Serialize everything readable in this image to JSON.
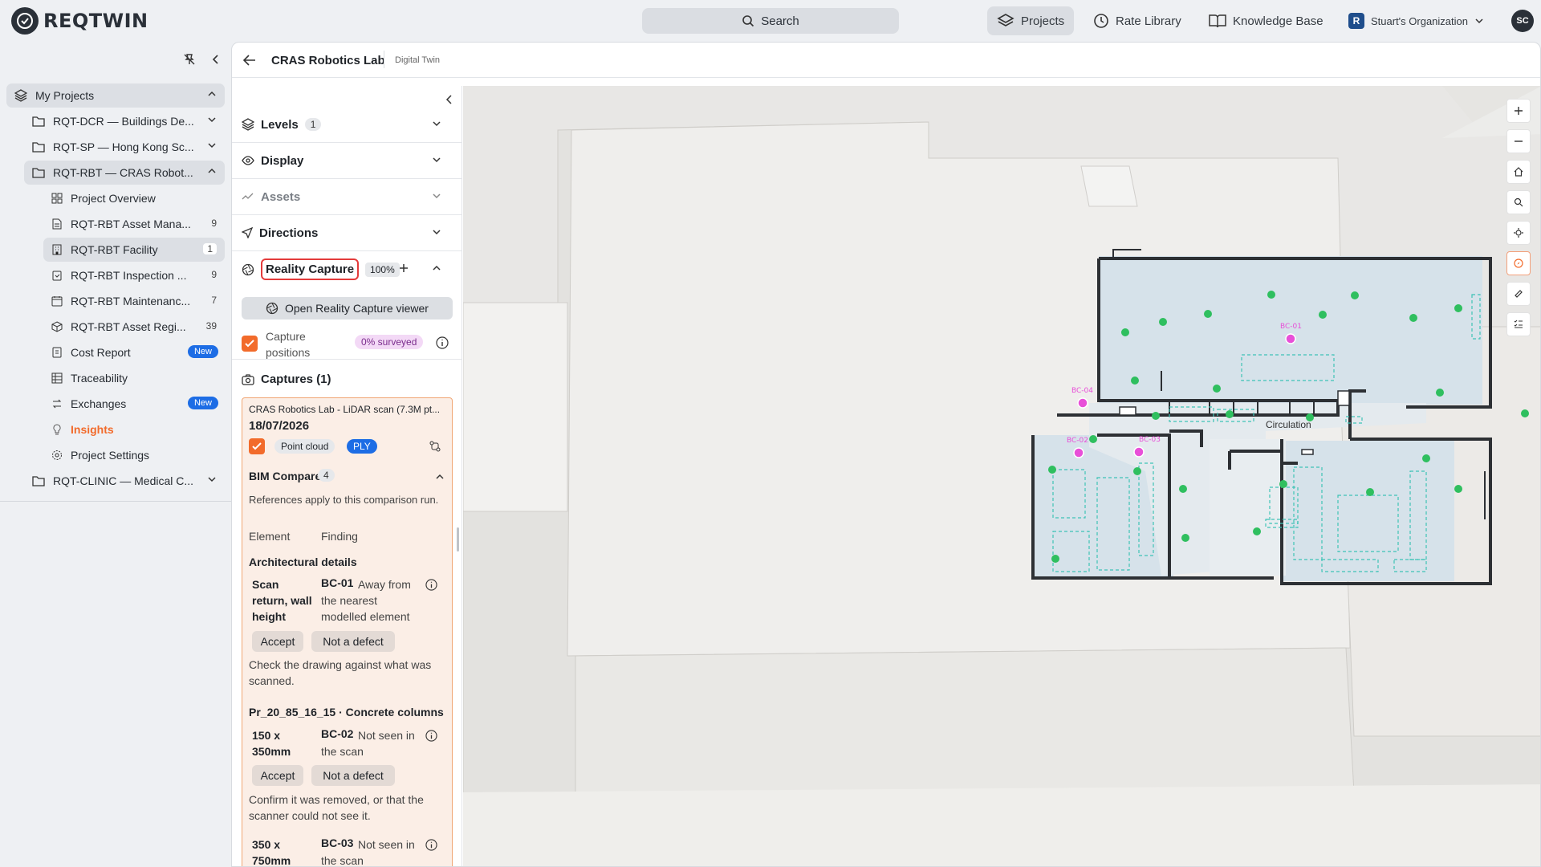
{
  "app": {
    "logo_text": "REQTWIN",
    "user_initials": "SC"
  },
  "topbar": {
    "search_label": "Search",
    "nav": [
      {
        "label": "Projects",
        "icon": "layers-icon",
        "active": true
      },
      {
        "label": "Rate Library",
        "icon": "rate-icon"
      },
      {
        "label": "Knowledge Base",
        "icon": "book-icon"
      }
    ],
    "org": {
      "badge": "R",
      "label": "Stuart's Organization"
    }
  },
  "sidebar": {
    "root_label": "My Projects",
    "projects": [
      {
        "label": "RQT-DCR — Buildings De..."
      },
      {
        "label": "RQT-SP — Hong Kong Sc..."
      },
      {
        "label": "RQT-RBT — CRAS Robot..."
      }
    ],
    "children": [
      {
        "label": "Project Overview",
        "icon": "grid-icon"
      },
      {
        "label": "RQT-RBT Asset Mana...",
        "icon": "document-icon",
        "count": "9"
      },
      {
        "label": "RQT-RBT Facility",
        "icon": "building-icon",
        "count": "1"
      },
      {
        "label": "RQT-RBT Inspection ...",
        "icon": "clipboard-icon",
        "count": "9"
      },
      {
        "label": "RQT-RBT Maintenanc...",
        "icon": "calendar-icon",
        "count": "7"
      },
      {
        "label": "RQT-RBT Asset Regi...",
        "icon": "cube-icon",
        "count": "39"
      },
      {
        "label": "Cost Report",
        "icon": "cost-icon",
        "badge": "New"
      },
      {
        "label": "Traceability",
        "icon": "table-icon"
      },
      {
        "label": "Exchanges",
        "icon": "exchange-icon",
        "badge": "New"
      },
      {
        "label": "Insights",
        "icon": "lightbulb-icon"
      },
      {
        "label": "Project Settings",
        "icon": "settings-icon"
      }
    ],
    "last_project": "RQT-CLINIC — Medical C..."
  },
  "breadcrumb": {
    "title": "CRAS Robotics Lab",
    "subtitle": "Digital Twin"
  },
  "panel": {
    "levels": {
      "label": "Levels",
      "count": "1"
    },
    "display": {
      "label": "Display"
    },
    "assets": {
      "label": "Assets"
    },
    "directions": {
      "label": "Directions"
    },
    "reality": {
      "label": "Reality Capture",
      "percent": "100%"
    },
    "open_viewer": "Open Reality Capture viewer",
    "capture_positions": "Capture positions",
    "surveyed": "0% surveyed",
    "captures_title": "Captures (1)",
    "capture": {
      "name": "CRAS Robotics Lab - LiDAR scan (7.3M pt...",
      "date": "18/07/2026",
      "tag1": "Point cloud",
      "tag2": "PLY"
    },
    "bim": {
      "title": "BIM Compare",
      "count": "4",
      "note": "References apply to this comparison run.",
      "col_element": "Element",
      "col_finding": "Finding",
      "groups": [
        {
          "heading": "Architectural details",
          "element": "Scan return, wall height",
          "code": "BC-01",
          "finding": "Away from the nearest modelled element",
          "accept": "Accept",
          "reject": "Not a defect",
          "hint": "Check the drawing against what was scanned."
        },
        {
          "heading": "Pr_20_85_16_15 · Concrete columns",
          "element": "150 x 350mm",
          "code": "BC-02",
          "finding": "Not seen in the scan",
          "accept": "Accept",
          "reject": "Not a defect",
          "hint": "Confirm it was removed, or that the scanner could not see it."
        },
        {
          "element": "350 x 750mm",
          "code": "BC-03",
          "finding": "Not seen in the scan"
        }
      ]
    }
  },
  "map": {
    "room_label": "Circulation",
    "markers": [
      "BC-01",
      "BC-02",
      "BC-03",
      "BC-04"
    ],
    "tools": [
      "zoom-in-icon",
      "zoom-out-icon",
      "home-icon",
      "search-icon",
      "locate-icon",
      "compass-icon",
      "measure-icon",
      "checklist-icon"
    ],
    "colors": {
      "accent": "#f26b2b",
      "capture_point": "#2fbf5f",
      "defect_marker": "#e84fd8"
    }
  }
}
